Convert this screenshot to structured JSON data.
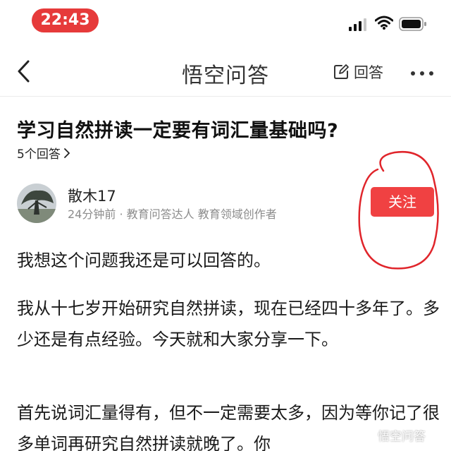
{
  "status_bar": {
    "time": "22:43"
  },
  "nav": {
    "title": "悟空问答",
    "answer_label": "回答"
  },
  "question": {
    "title": "学习自然拼读一定要有词汇量基础吗?",
    "answer_count": "5个回答"
  },
  "author": {
    "name": "散木17",
    "meta": "24分钟前 · 教育问答达人 教育领域创作者",
    "follow_label": "关注"
  },
  "body": {
    "p1": "我想这个问题我还是可以回答的。",
    "p2": "我从十七岁开始研究自然拼读，现在已经四十多年了。多少还是有点经验。今天就和大家分享一下。",
    "p3": "首先说词汇量得有，但不一定需要太多，因为等你记了很多单词再研究自然拼读就晚了。你"
  },
  "watermark": {
    "text": "悟空问答"
  },
  "colors": {
    "accent": "#f04142",
    "time_pill": "#e63a3a",
    "annotation": "#e0252b"
  }
}
